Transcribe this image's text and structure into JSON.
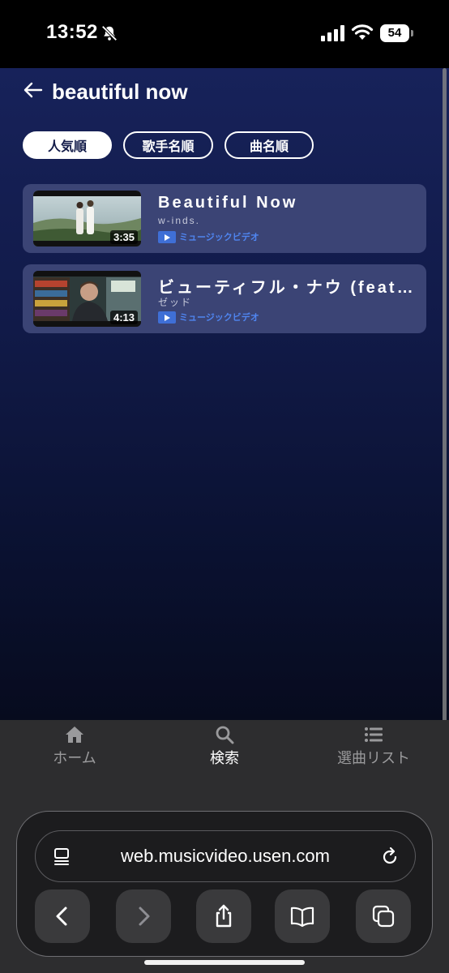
{
  "status_bar": {
    "time": "13:52",
    "battery": "54"
  },
  "header": {
    "title": "beautiful now"
  },
  "sort_tabs": [
    {
      "label": "人気順",
      "active": true
    },
    {
      "label": "歌手名順",
      "active": false
    },
    {
      "label": "曲名順",
      "active": false
    }
  ],
  "results": [
    {
      "title": "Beautiful Now",
      "artist": "w-inds.",
      "duration": "3:35",
      "type": "ミュージックビデオ"
    },
    {
      "title": "ビューティフル・ナウ (feat. ジョン・ベリオン)",
      "artist": "ゼッド",
      "duration": "4:13",
      "type": "ミュージックビデオ"
    }
  ],
  "bottom_nav": [
    {
      "label": "ホーム",
      "icon": "home-icon"
    },
    {
      "label": "検索",
      "icon": "search-icon",
      "active": true
    },
    {
      "label": "選曲リスト",
      "icon": "list-icon"
    }
  ],
  "browser": {
    "url": "web.musicvideo.usen.com"
  },
  "colors": {
    "background_top": "#17225a",
    "card": "#3b4475",
    "accent_blue": "#4f85f0"
  }
}
